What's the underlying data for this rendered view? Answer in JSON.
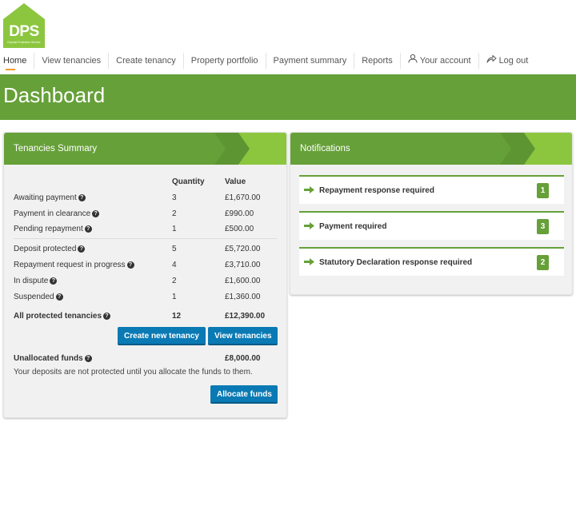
{
  "logo": {
    "text": "DPS",
    "subtext": "Deposit Protection Service",
    "color": "#8cc63f"
  },
  "nav": {
    "items": [
      "Home",
      "View tenancies",
      "Create tenancy",
      "Property portfolio",
      "Payment summary",
      "Reports"
    ],
    "account": "Your account",
    "logout": "Log out"
  },
  "page": {
    "title": "Dashboard"
  },
  "summary": {
    "title": "Tenancies Summary",
    "headers": {
      "quantity": "Quantity",
      "value": "Value"
    },
    "groups": [
      [
        {
          "label": "Awaiting payment",
          "qty": "3",
          "value": "£1,670.00"
        },
        {
          "label": "Payment in clearance",
          "qty": "2",
          "value": "£990.00"
        },
        {
          "label": "Pending repayment",
          "qty": "1",
          "value": "£500.00"
        }
      ],
      [
        {
          "label": "Deposit protected",
          "qty": "5",
          "value": "£5,720.00"
        },
        {
          "label": "Repayment request in progress",
          "qty": "4",
          "value": "£3,710.00"
        },
        {
          "label": "In dispute",
          "qty": "2",
          "value": "£1,600.00"
        },
        {
          "label": "Suspended",
          "qty": "1",
          "value": "£1,360.00"
        }
      ]
    ],
    "total": {
      "label": "All protected tenancies",
      "qty": "12",
      "value": "£12,390.00"
    },
    "buttons": {
      "create": "Create new tenancy",
      "view": "View tenancies"
    },
    "unallocated": {
      "label": "Unallocated funds",
      "value": "£8,000.00"
    },
    "note": "Your deposits are not protected until you allocate the funds to them.",
    "allocate": "Allocate funds"
  },
  "notifications": {
    "title": "Notifications",
    "items": [
      {
        "label": "Repayment response required",
        "count": "1"
      },
      {
        "label": "Payment required",
        "count": "3"
      },
      {
        "label": "Statutory Declaration response required",
        "count": "2"
      }
    ]
  },
  "colors": {
    "brand_green": "#66a038",
    "accent_green": "#8cc63f",
    "button_blue": "#0a7ab4",
    "nav_active": "#f29a2e"
  }
}
